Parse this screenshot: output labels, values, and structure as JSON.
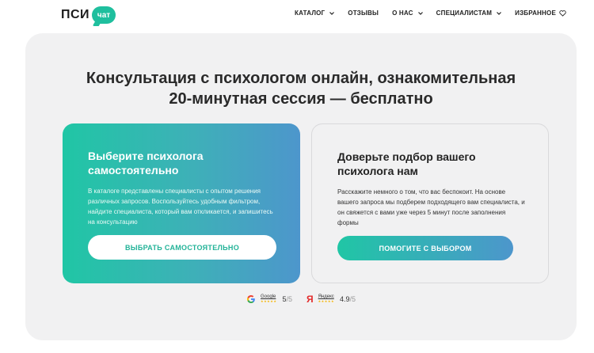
{
  "header": {
    "logo_text": "ПСИ",
    "logo_bubble": "чат",
    "nav": [
      {
        "label": "КАТАЛОГ",
        "has_dropdown": true
      },
      {
        "label": "ОТЗЫВЫ",
        "has_dropdown": false
      },
      {
        "label": "О НАС",
        "has_dropdown": true
      },
      {
        "label": "СПЕЦИАЛИСТАМ",
        "has_dropdown": true
      },
      {
        "label": "ИЗБРАННОЕ",
        "icon": "heart-icon"
      }
    ]
  },
  "hero": {
    "title_line1": "Консультация с психологом онлайн, ознакомительная",
    "title_line2": "20-минутная сессия — бесплатно",
    "left_card": {
      "title": "Выберите психолога самостоятельно",
      "text": "В каталоге представлены специалисты с опытом решения различных запросов. Воспользуйтесь удобным фильтром, найдите специалиста, который вам откликается, и запишитесь на консультацию",
      "button": "ВЫБРАТЬ САМОСТОЯТЕЛЬНО"
    },
    "right_card": {
      "title": "Доверьте подбор вашего психолога нам",
      "text": "Расскажите немного о том, что вас беспокоит. На основе вашего запроса мы подберем подходящего вам специалиста, и он свяжется с вами уже через 5 минут после заполнения формы",
      "button": "ПОМОГИТЕ С ВЫБОРОМ"
    }
  },
  "ratings": [
    {
      "name": "Google",
      "score": "5",
      "max": "/5",
      "stars": "★★★★★",
      "icon": "google-icon"
    },
    {
      "name": "Яндекс",
      "score": "4.9",
      "max": "/5",
      "stars": "★★★★★",
      "icon": "yandex-icon"
    }
  ],
  "colors": {
    "accent_green": "#1fbf9e",
    "accent_blue": "#4d96cc",
    "panel_bg": "#f1f1f2"
  }
}
